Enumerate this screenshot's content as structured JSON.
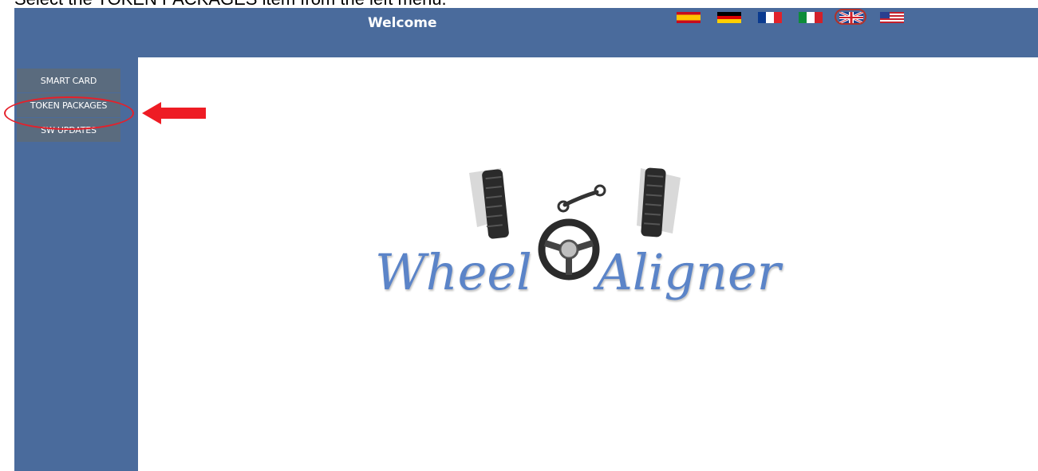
{
  "instruction": "Select the TOKEN PACKAGES item from the left menu.",
  "header": {
    "title": "Welcome",
    "languages": [
      {
        "name": "spanish-flag-icon",
        "selected": false
      },
      {
        "name": "german-flag-icon",
        "selected": false
      },
      {
        "name": "french-flag-icon",
        "selected": false
      },
      {
        "name": "italian-flag-icon",
        "selected": false
      },
      {
        "name": "uk-flag-icon",
        "selected": true
      },
      {
        "name": "us-flag-icon",
        "selected": false
      }
    ]
  },
  "menu": {
    "items": [
      {
        "label": "SMART CARD"
      },
      {
        "label": "TOKEN PACKAGES"
      },
      {
        "label": "SW UPDATES"
      }
    ],
    "highlighted": "TOKEN PACKAGES"
  },
  "logo": {
    "word1": "Wheel",
    "word2": "Aligner"
  },
  "colors": {
    "header_bg": "#4a6b9c",
    "menu_item_bg": "#5a6b7e",
    "annotation": "#e5202a",
    "logo_text": "#5b84c8"
  }
}
